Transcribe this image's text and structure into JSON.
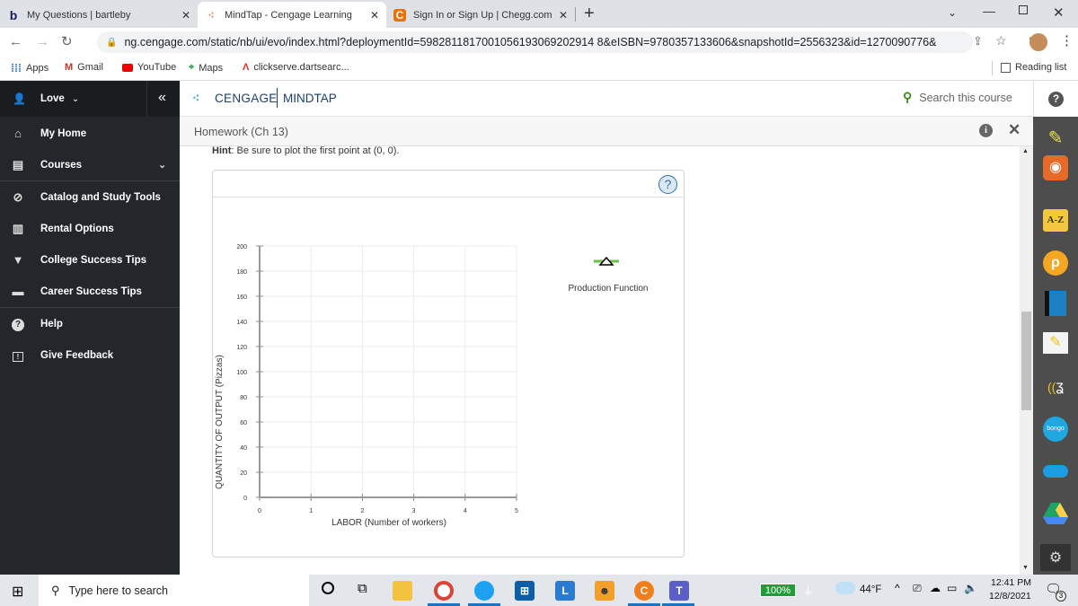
{
  "browser": {
    "tabs": [
      {
        "title": "My Questions | bartleby",
        "icon": "bartleby-icon",
        "glyph": "b",
        "active": false
      },
      {
        "title": "MindTap - Cengage Learning",
        "icon": "cengage-icon",
        "glyph": "⁖",
        "active": true
      },
      {
        "title": "Sign In or Sign Up | Chegg.com",
        "icon": "chegg-icon",
        "glyph": "C",
        "active": false
      }
    ],
    "new_tab": "+",
    "close_glyph": "✕",
    "url": "ng.cengage.com/static/nb/ui/evo/index.html?deploymentId=5982811817001056193069202914 8&eISBN=9780357133606&snapshotId=2556323&id=1270090776&",
    "bookmarks": [
      {
        "label": "Apps",
        "icon": "apps-grid-icon"
      },
      {
        "label": "Gmail",
        "icon": "gmail-icon"
      },
      {
        "label": "YouTube",
        "icon": "youtube-icon"
      },
      {
        "label": "Maps",
        "icon": "maps-icon"
      },
      {
        "label": "clickserve.dartsearc...",
        "icon": "clickserve-icon"
      }
    ],
    "reading_list": "Reading list"
  },
  "sidebar": {
    "user": "Love",
    "collapse_glyph": "«",
    "items": [
      {
        "label": "My Home",
        "icon": "home-icon",
        "glyph": "⌂"
      },
      {
        "label": "Courses",
        "icon": "book-icon",
        "glyph": "▤"
      },
      {
        "label": "Catalog and Study Tools",
        "icon": "compass-icon",
        "glyph": "⊘"
      },
      {
        "label": "Rental Options",
        "icon": "open-book-icon",
        "glyph": "▥"
      },
      {
        "label": "College Success Tips",
        "icon": "graduation-cap-icon",
        "glyph": "🎓"
      },
      {
        "label": "Career Success Tips",
        "icon": "briefcase-icon",
        "glyph": "▬"
      },
      {
        "label": "Help",
        "icon": "help-icon",
        "glyph": "?"
      },
      {
        "label": "Give Feedback",
        "icon": "feedback-icon",
        "glyph": "!"
      }
    ]
  },
  "header": {
    "brand": "CENGAGE",
    "product": "MINDTAP",
    "search_placeholder": "Search this course",
    "assignment_title": "Homework (Ch 13)"
  },
  "content": {
    "hint_label": "Hint",
    "hint_text": ": Be sure to plot the first point at (0, 0).",
    "help_glyph": "?"
  },
  "chart_data": {
    "type": "line",
    "title": "",
    "xlabel": "LABOR (Number of workers)",
    "ylabel": "QUANTITY OF OUTPUT (Pizzas)",
    "xlim": [
      0,
      5
    ],
    "ylim": [
      0,
      200
    ],
    "x_ticks": [
      0,
      1,
      2,
      3,
      4,
      5
    ],
    "y_ticks": [
      0,
      20,
      40,
      60,
      80,
      100,
      120,
      140,
      160,
      180,
      200
    ],
    "grid": true,
    "series": [
      {
        "name": "Production Function",
        "x": [],
        "y": [],
        "color": "#6abf4b",
        "marker": "triangle"
      }
    ],
    "legend": {
      "label": "Production Function",
      "placement": "right"
    }
  },
  "dock": {
    "apps": [
      "rss-icon",
      "a-z-icon",
      "p-app-icon",
      "book-blue-icon",
      "notebook-highlighter-icon",
      "readspeaker-icon",
      "bongo-icon",
      "onedrive-icon",
      "google-drive-icon",
      "settings-app-icon"
    ],
    "az_label": "A-Z",
    "bongo_label": "bongo"
  },
  "taskbar": {
    "search_placeholder": "Type here to search",
    "battery": "100%",
    "weather": "44°F",
    "time": "12:41 PM",
    "date": "12/8/2021",
    "notifications": "3"
  }
}
